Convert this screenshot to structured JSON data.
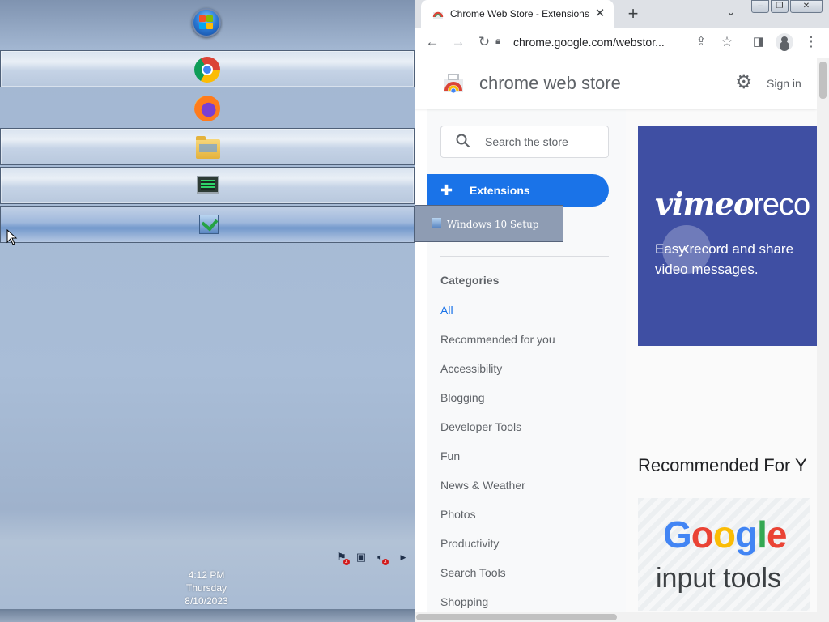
{
  "taskbar": {
    "buttons": [
      {
        "name": "start-button",
        "app": "Windows Start"
      },
      {
        "name": "Google Chrome",
        "icon": "chrome-icon"
      },
      {
        "name": "Firefox",
        "icon": "firefox-icon"
      },
      {
        "name": "File Explorer",
        "icon": "folder-icon"
      },
      {
        "name": "System Monitor",
        "icon": "monitor-icon"
      },
      {
        "name": "Windows 10 Setup",
        "icon": "setup-icon"
      }
    ],
    "tooltip": "Windows 10 Setup",
    "tray": {
      "icons": [
        "flag-icon",
        "network-icon",
        "volume-muted-icon",
        "show-hidden-icon"
      ]
    },
    "clock": {
      "time": "4:12 PM",
      "day": "Thursday",
      "date": "8/10/2023"
    }
  },
  "browser": {
    "tab_title": "Chrome Web Store - Extensions",
    "tab_close": "✕",
    "new_tab": "+",
    "url": "chrome.google.com/webstor...",
    "colors": {
      "accent": "#1a73e8",
      "tabstrip": "#dee1e6"
    }
  },
  "store": {
    "title": "chrome web store",
    "sign_in": "Sign in",
    "search_placeholder": "Search the store",
    "nav_selected": "Extensions",
    "categories_heading": "Categories",
    "categories": [
      "All",
      "Recommended for you",
      "Accessibility",
      "Blogging",
      "Developer Tools",
      "Fun",
      "News & Weather",
      "Photos",
      "Productivity",
      "Search Tools",
      "Shopping"
    ],
    "banner": {
      "logo_bold": "vimeo",
      "logo_thin": "reco",
      "subtitle_1": "Easy record and share",
      "subtitle_2": "video messages.",
      "color": "#3f4fa3"
    },
    "recommended_heading": "Recommended For Y",
    "card": {
      "brand": "Google",
      "subtitle": "input tools"
    }
  }
}
